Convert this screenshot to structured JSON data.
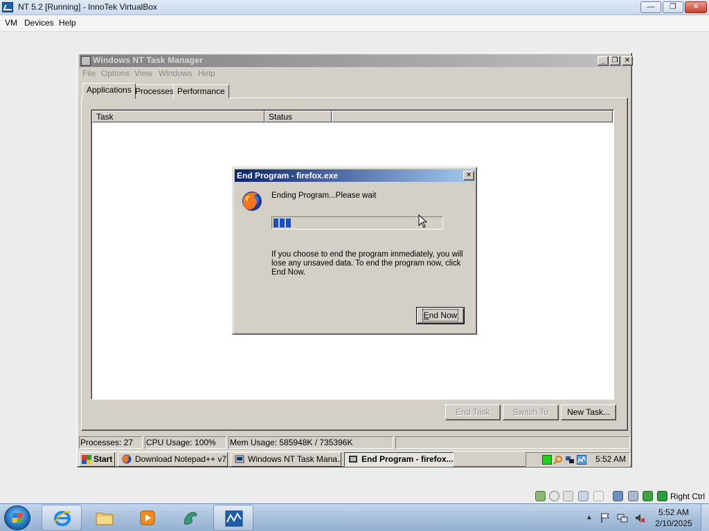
{
  "host_window": {
    "title": "NT 5.2 [Running] - InnoTek VirtualBox",
    "controls": {
      "minimize": "—",
      "maximize": "❐",
      "close": "✕"
    },
    "menu": [
      "VM",
      "Devices",
      "Help"
    ]
  },
  "task_manager": {
    "title": "Windows NT Task Manager",
    "menu": [
      "File",
      "Options",
      "View",
      "Windows",
      "Help"
    ],
    "tabs": [
      "Applications",
      "Processes",
      "Performance"
    ],
    "active_tab": "Applications",
    "columns": [
      "Task",
      "Status"
    ],
    "buttons": {
      "end_task": "End Task",
      "switch_to": "Switch To",
      "new_task": "New Task..."
    },
    "status": {
      "processes": "Processes: 27",
      "cpu": "CPU Usage: 100%",
      "mem": "Mem Usage: 585948K / 735396K"
    },
    "window_controls": {
      "minimize": "_",
      "maximize": "❐",
      "close": "✕"
    }
  },
  "guest_taskbar": {
    "start": "Start",
    "tasks": [
      {
        "label": "Download Notepad++ v7....",
        "active": false
      },
      {
        "label": "Windows NT Task Mana...",
        "active": false
      },
      {
        "label": "End Program - firefox....",
        "active": true
      }
    ],
    "clock": "5:52 AM"
  },
  "dialog": {
    "title": "End Program - firefox.exe",
    "message": "Ending Program...Please wait",
    "progress": 0.11,
    "info": "If you choose to end the program immediately, you will lose any unsaved data. To end the program now, click End Now.",
    "end_now_prefix": "E",
    "end_now_rest": "nd Now",
    "close": "✕"
  },
  "vbox_status": {
    "host_key": "Right Ctrl"
  },
  "win7_taskbar": {
    "clock_time": "5:52 AM",
    "clock_date": "2/10/2025",
    "tray_arrow": "▲"
  }
}
